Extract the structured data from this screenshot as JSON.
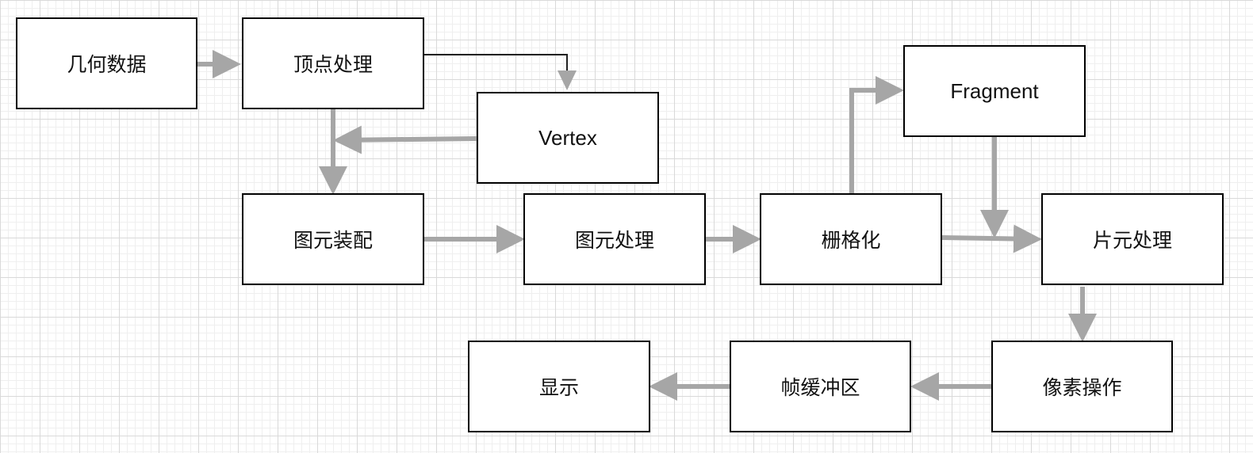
{
  "colors": {
    "arrow": "#a6a6a6",
    "thin_arrow": "#222222",
    "box_border": "#000000"
  },
  "nodes": {
    "geometry_data": "几何数据",
    "vertex_processing": "顶点处理",
    "vertex": "Vertex",
    "primitive_assembly": "图元装配",
    "primitive_processing": "图元处理",
    "rasterization": "栅格化",
    "fragment": "Fragment",
    "fragment_processing": "片元处理",
    "pixel_operations": "像素操作",
    "frame_buffer": "帧缓冲区",
    "display": "显示"
  }
}
